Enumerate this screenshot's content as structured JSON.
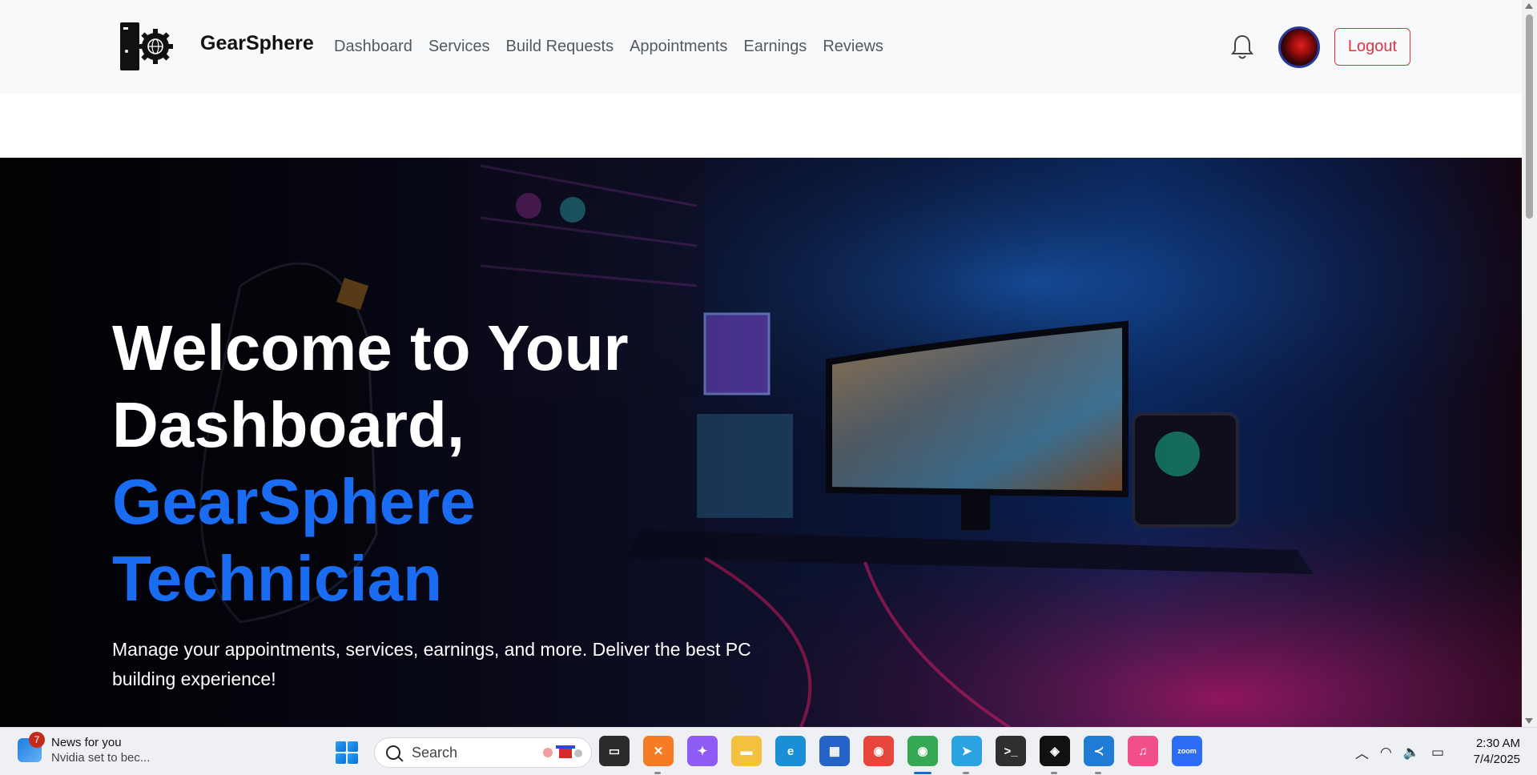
{
  "navbar": {
    "brand": "GearSphere",
    "links": [
      "Dashboard",
      "Services",
      "Build Requests",
      "Appointments",
      "Earnings",
      "Reviews"
    ],
    "logout_label": "Logout",
    "bell_icon": "bell-icon",
    "avatar_icon": "user-avatar"
  },
  "hero": {
    "title_line1": "Welcome to Your",
    "title_line2": "Dashboard,",
    "title_accent1": "GearSphere",
    "title_accent2": "Technician",
    "subtitle": "Manage your appointments, services, earnings, and more. Deliver the best PC building experience!",
    "accent_color": "#1a6cf2"
  },
  "taskbar": {
    "news_badge": "7",
    "news_title": "News for you",
    "news_sub": "Nvidia set to bec...",
    "search_placeholder": "Search",
    "apps": [
      {
        "name": "task-view-icon",
        "bg": "#2b2b2b",
        "glyph": "▭"
      },
      {
        "name": "xampp-icon",
        "bg": "#f57c25",
        "glyph": "✕"
      },
      {
        "name": "copilot-icon",
        "bg": "#8e5cf5",
        "glyph": "✦"
      },
      {
        "name": "file-explorer-icon",
        "bg": "#f3c23c",
        "glyph": "▬"
      },
      {
        "name": "edge-icon",
        "bg": "#1a8fd6",
        "glyph": "e"
      },
      {
        "name": "microsoft-store-icon",
        "bg": "#2563c9",
        "glyph": "▦"
      },
      {
        "name": "chrome-icon",
        "bg": "#e8453c",
        "glyph": "◉"
      },
      {
        "name": "chrome-profile-icon",
        "bg": "#34a853",
        "glyph": "◉"
      },
      {
        "name": "telegram-icon",
        "bg": "#2aa3e0",
        "glyph": "➤"
      },
      {
        "name": "terminal-icon",
        "bg": "#2f2f2f",
        "glyph": ">_"
      },
      {
        "name": "capcut-icon",
        "bg": "#111111",
        "glyph": "◈"
      },
      {
        "name": "vscode-icon",
        "bg": "#1f7bd6",
        "glyph": "≺"
      },
      {
        "name": "itunes-icon",
        "bg": "#f04f8c",
        "glyph": "♫"
      },
      {
        "name": "zoom-icon",
        "bg": "#2d6cf5",
        "glyph": "zoom"
      }
    ],
    "time": "2:30 AM",
    "date": "7/4/2025"
  }
}
